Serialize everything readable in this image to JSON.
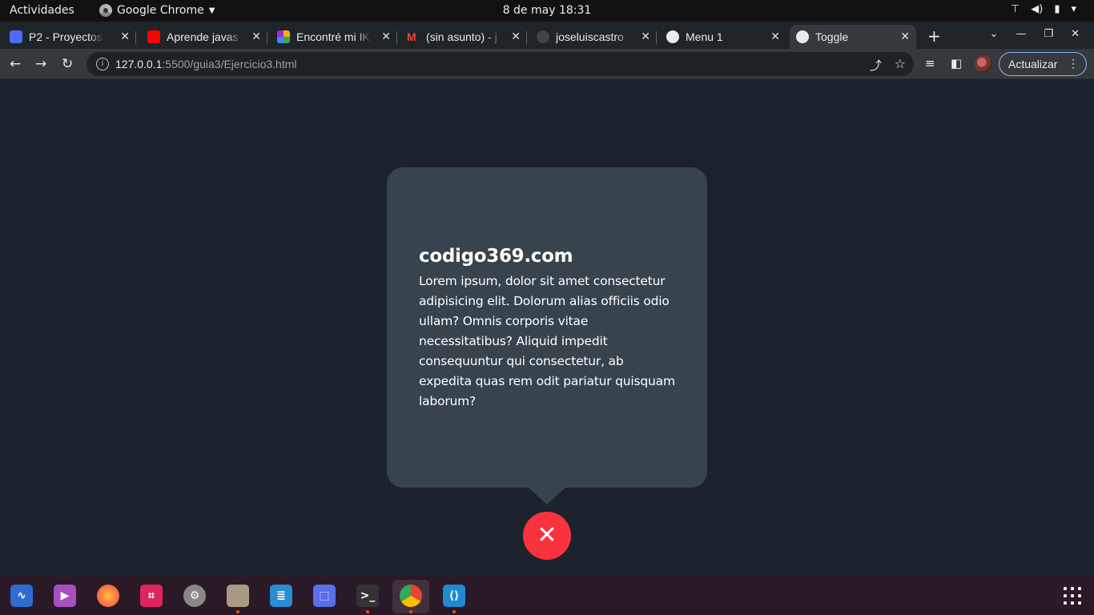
{
  "topbar": {
    "activities": "Actividades",
    "app_name": "Google Chrome",
    "clock": "8 de may  18:31"
  },
  "tabs": [
    {
      "title": "P2 - Proyectos",
      "icon": "calendar-icon",
      "color": "#4a6cf7"
    },
    {
      "title": "Aprende javas",
      "icon": "youtube-icon",
      "color": "#ff0000"
    },
    {
      "title": "Encontré mi IK",
      "icon": "app-icon",
      "color": "#9b2dd3"
    },
    {
      "title": "(sin asunto) - j",
      "icon": "gmail-icon",
      "color": "#ea4335"
    },
    {
      "title": "joseluiscastro",
      "icon": "github-icon",
      "color": "#333333"
    },
    {
      "title": "Menu 1",
      "icon": "globe-icon",
      "color": "#e8eaed"
    },
    {
      "title": "Toggle",
      "icon": "globe-icon",
      "color": "#e8eaed"
    }
  ],
  "address_bar": {
    "host": "127.0.0.1",
    "rest": ":5500/guia3/Ejercicio3.html"
  },
  "update_button": "Actualizar",
  "card": {
    "title": "codigo369.com",
    "body": "Lorem ipsum, dolor sit amet consectetur adipisicing elit. Dolorum alias officiis odio ullam? Omnis corporis vitae necessitatibus? Aliquid impedit consequuntur qui consectetur, ab expedita quas rem odit pariatur quisquam laborum?"
  },
  "close_button_glyph": "✕",
  "colors": {
    "page_bg": "#1b222b",
    "card_bg": "#37434d",
    "close_button": "#f8323f"
  },
  "dock_apps": [
    {
      "name": "system-monitor",
      "color": "#2f6bd1",
      "running": false,
      "pip": false
    },
    {
      "name": "video-player",
      "color": "#a64fbf",
      "running": false,
      "pip": false
    },
    {
      "name": "firefox",
      "color": "#ff7139",
      "running": false,
      "pip": false
    },
    {
      "name": "screenshot-tool",
      "color": "#e0245e",
      "running": false,
      "pip": false
    },
    {
      "name": "settings",
      "color": "#888888",
      "running": false,
      "pip": false
    },
    {
      "name": "files",
      "color": "#a89a84",
      "running": false,
      "pip": true
    },
    {
      "name": "libreoffice-writer",
      "color": "#2a8cd3",
      "running": false,
      "pip": false
    },
    {
      "name": "screenshot",
      "color": "#5a6ee8",
      "running": false,
      "pip": false
    },
    {
      "name": "terminal",
      "color": "#333333",
      "running": false,
      "pip": true
    },
    {
      "name": "chrome",
      "color": "#34a853",
      "running": true,
      "pip": true
    },
    {
      "name": "vscode",
      "color": "#1f8ad2",
      "running": false,
      "pip": true
    }
  ]
}
